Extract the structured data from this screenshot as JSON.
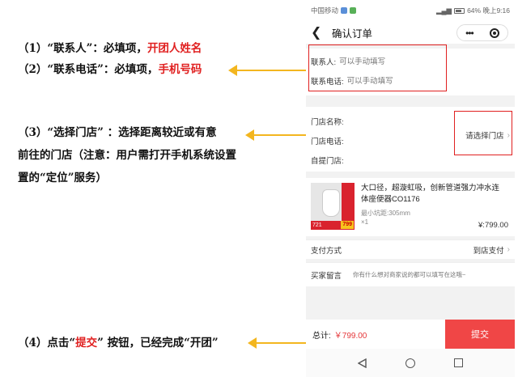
{
  "instructions": [
    {
      "prefix": "（1）“联系人”：必填项，",
      "highlight": "开团人姓名",
      "suffix": ""
    },
    {
      "prefix": "（2）“联系电话”：必填项，",
      "highlight": "手机号码",
      "suffix": ""
    },
    {
      "line1": "（3）“选择门店” ：选择距离较近或有意",
      "line2": "前往的门店（注意：用户需打开手机系统设置",
      "line3": "置的“定位”服务）"
    },
    {
      "prefix": "（4）点击“",
      "highlight": "提交",
      "suffix": "” 按钮，已经完成“开团”"
    }
  ],
  "status_bar": {
    "carrier": "中国移动",
    "right": "64%  晚上9:16"
  },
  "nav": {
    "title": "确认订单",
    "more": "•••"
  },
  "contact": {
    "name_label": "联系人:",
    "name_placeholder": "可以手动填写",
    "phone_label": "联系电话:",
    "phone_placeholder": "可以手动填写"
  },
  "store": {
    "name_label": "门店名称:",
    "phone_label": "门店电话:",
    "address_label": "自提门店:",
    "choose_label": "请选择门店"
  },
  "product": {
    "title": "大口径，超漩虹吸，创新管道强力冲水连体座便器CO1176",
    "spec": "最小坑距:305mm",
    "qty": "×1",
    "price": "¥:799.00",
    "thumb_tag": "721",
    "thumb_price": "799"
  },
  "payment": {
    "label": "支付方式",
    "value": "到店支付"
  },
  "message": {
    "label": "买家留言",
    "placeholder": "你有什么想对商家说的都可以填写在这哦~"
  },
  "footer": {
    "total_label": "总计:",
    "total_value": "￥799.00",
    "submit_label": "提交"
  },
  "colors": {
    "accent_red": "#f04646",
    "highlight_red": "#e02020",
    "arrow_yellow": "#f3b61f"
  }
}
